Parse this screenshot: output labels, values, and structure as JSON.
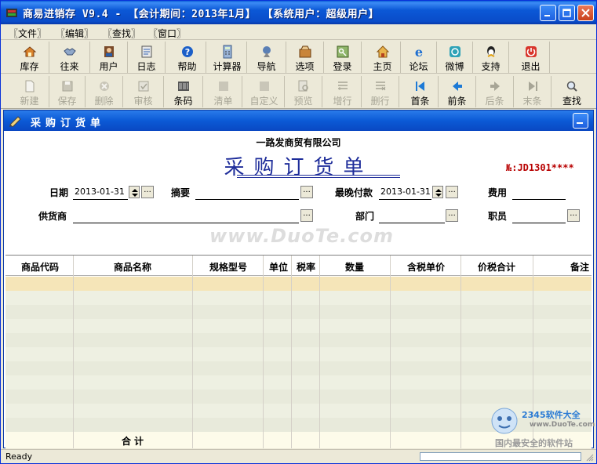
{
  "window": {
    "title": "商易进销存 V9.4 - 【会计期间：2013年1月】 【系统用户：超级用户】"
  },
  "menu": [
    {
      "label": "〖文件〗"
    },
    {
      "label": "〖编辑〗"
    },
    {
      "label": "〖查找〗"
    },
    {
      "label": "〖窗口〗"
    }
  ],
  "toolbar1": [
    {
      "label": "库存",
      "icon": "house-icon"
    },
    {
      "label": "往来",
      "icon": "handshake-icon"
    },
    {
      "label": "用户",
      "icon": "user-icon"
    },
    {
      "label": "日志",
      "icon": "log-icon"
    },
    {
      "label": "帮助",
      "icon": "help-icon"
    },
    {
      "label": "计算器",
      "icon": "calculator-icon"
    },
    {
      "label": "导航",
      "icon": "navigation-icon"
    },
    {
      "label": "选项",
      "icon": "options-icon"
    },
    {
      "label": "登录",
      "icon": "key-icon"
    },
    {
      "label": "主页",
      "icon": "home-icon"
    },
    {
      "label": "论坛",
      "icon": "ie-icon"
    },
    {
      "label": "微博",
      "icon": "weibo-icon"
    },
    {
      "label": "支持",
      "icon": "qq-icon"
    },
    {
      "label": "退出",
      "icon": "power-icon"
    }
  ],
  "toolbar2": [
    {
      "label": "新建",
      "icon": "new-doc-icon",
      "enabled": false
    },
    {
      "label": "保存",
      "icon": "save-icon",
      "enabled": false
    },
    {
      "label": "删除",
      "icon": "delete-icon",
      "enabled": false
    },
    {
      "label": "审核",
      "icon": "approve-icon",
      "enabled": false
    },
    {
      "label": "条码",
      "icon": "barcode-icon",
      "enabled": true
    },
    {
      "label": "清单",
      "icon": "list-icon",
      "enabled": false
    },
    {
      "label": "自定义",
      "icon": "custom-icon",
      "enabled": false
    },
    {
      "label": "预览",
      "icon": "preview-icon",
      "enabled": false
    },
    {
      "label": "增行",
      "icon": "add-row-icon",
      "enabled": false
    },
    {
      "label": "删行",
      "icon": "delete-row-icon",
      "enabled": false
    },
    {
      "label": "首条",
      "icon": "first-record-icon",
      "enabled": true
    },
    {
      "label": "前条",
      "icon": "prev-record-icon",
      "enabled": true
    },
    {
      "label": "后条",
      "icon": "next-record-icon",
      "enabled": false
    },
    {
      "label": "末条",
      "icon": "last-record-icon",
      "enabled": false
    },
    {
      "label": "查找",
      "icon": "magnifier-icon",
      "enabled": true
    }
  ],
  "form": {
    "window_title": "采购订货单",
    "company": "一路发商贸有限公司",
    "doc_title": "采购订货单",
    "doc_no": "№:JD1301****",
    "fields": {
      "date_label": "日期",
      "date_value": "2013-01-31",
      "summary_label": "摘要",
      "summary_value": "",
      "latest_pay_label": "最晚付款",
      "latest_pay_value": "2013-01-31",
      "fee_label": "费用",
      "fee_value": "",
      "supplier_label": "供货商",
      "supplier_value": "",
      "dept_label": "部门",
      "dept_value": "",
      "staff_label": "职员",
      "staff_value": ""
    },
    "dots": "...",
    "grid": {
      "columns": [
        "商品代码",
        "商品名称",
        "规格型号",
        "单位",
        "税率",
        "数量",
        "含税单价",
        "价税合计",
        "备注"
      ],
      "totals_label": "合计"
    },
    "watermark": "www.DuoTe.com"
  },
  "status": {
    "text": "Ready"
  },
  "branding": {
    "logo_main": "2345软件大全",
    "logo_url": "www.DuoTe.com",
    "logo_slogan": "国内最安全的软件站"
  },
  "colors": {
    "title_blue": "#0a4cc9",
    "doc_title_blue": "#1e2d9a",
    "doc_no_red": "#b80000",
    "row_highlight": "#f5e5b8",
    "row_alt": "#eef0e2"
  }
}
